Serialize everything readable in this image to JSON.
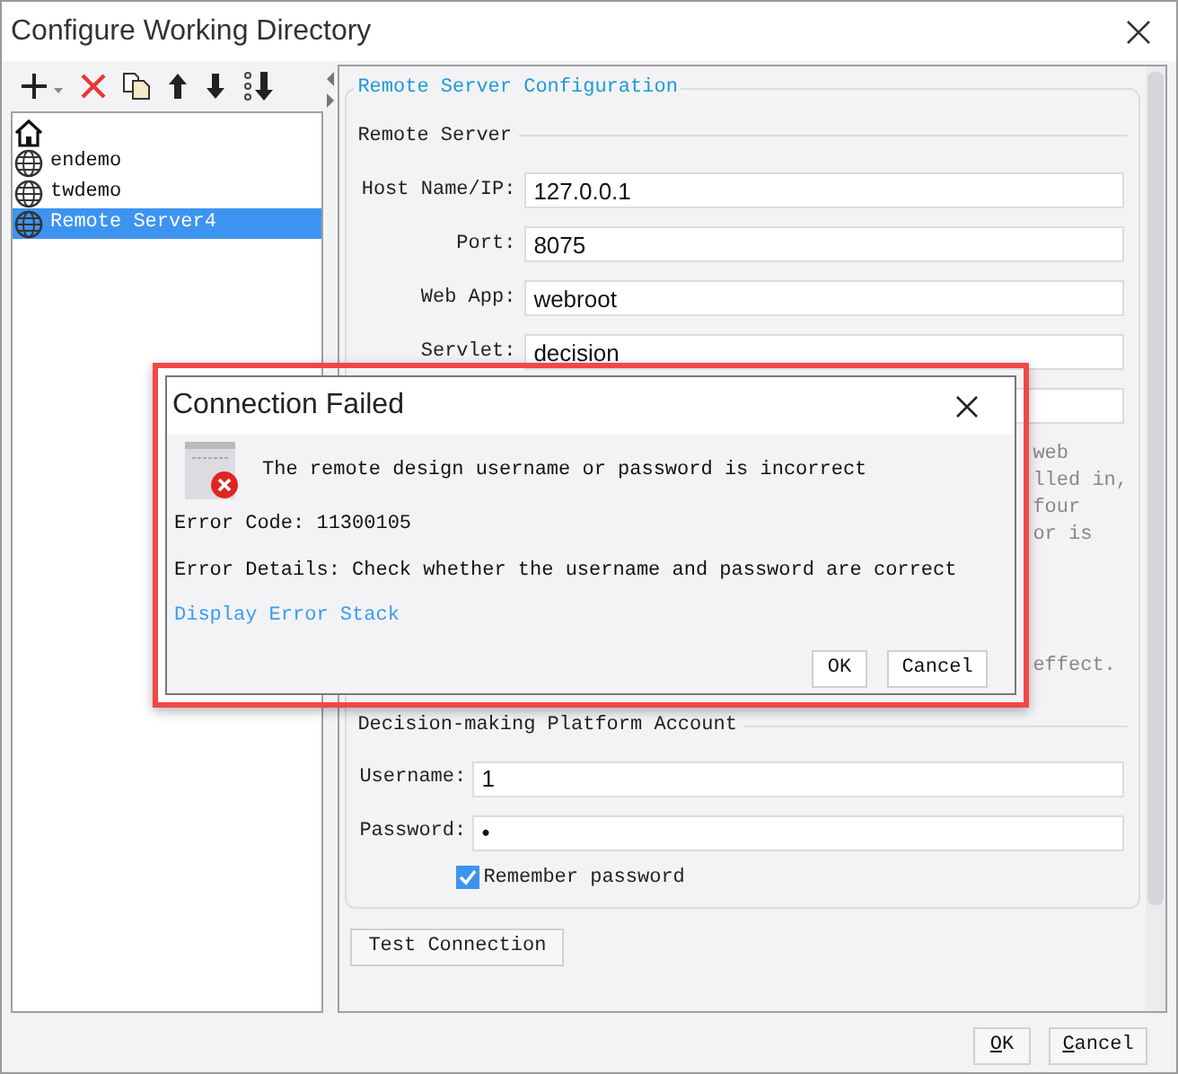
{
  "window": {
    "title": "Configure Working Directory"
  },
  "tree": [
    {
      "kind": "home",
      "selected": false
    },
    {
      "kind": "server",
      "label": "endemo",
      "selected": false
    },
    {
      "kind": "server",
      "label": "twdemo",
      "selected": false
    },
    {
      "kind": "server",
      "label": "Remote Server4",
      "selected": true
    }
  ],
  "config": {
    "title": "Remote Server Configuration",
    "section": "Remote Server",
    "fields": [
      {
        "kind": "text",
        "label": "Host Name/IP:",
        "value": "127.0.0.1"
      },
      {
        "kind": "text",
        "label": "Port:",
        "value": "8075"
      },
      {
        "kind": "text",
        "label": "Web App:",
        "value": "webroot"
      },
      {
        "kind": "text",
        "label": "Servlet:",
        "value": "decision"
      },
      {
        "kind": "covered"
      }
    ],
    "note_fragments": [
      "web",
      "lled in,",
      "four",
      "or is",
      "effect."
    ],
    "account": {
      "title": "Decision-making Platform Account",
      "fields": [
        {
          "label": "Username:",
          "value": "1"
        },
        {
          "label": "Password:",
          "value": "•"
        }
      ],
      "remember": {
        "label": "Remember password",
        "checked": true
      }
    },
    "test_button": "Test Connection"
  },
  "buttons": [
    "OK",
    "Cancel"
  ],
  "dialog": {
    "title": "Connection Failed",
    "message": "The remote design username or password is incorrect",
    "error_code": "Error Code: 11300105",
    "error_details": "Error Details: Check whether the username and password are correct",
    "link": "Display Error Stack",
    "buttons": [
      "OK",
      "Cancel"
    ]
  }
}
